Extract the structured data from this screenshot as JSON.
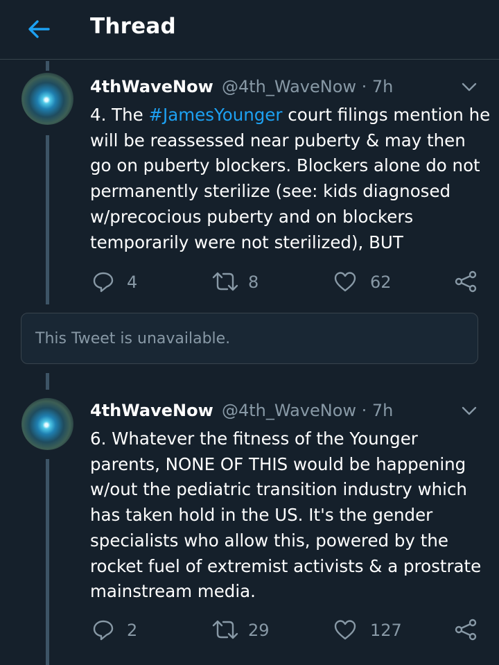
{
  "header": {
    "title": "Thread",
    "back_icon": "arrow-left-icon",
    "accent": "#1da1f2"
  },
  "tweets": [
    {
      "name": "4thWaveNow",
      "handle": "@4th_WaveNow · 7h",
      "text_prefix": "4. The ",
      "hashtag": "#JamesYounger",
      "text_rest": " court filings mention he will be reassessed near puberty & may then go on puberty blockers. Blockers alone do not permanently sterilize (see: kids diagnosed w/precocious puberty and on blockers temporarily were not sterilized), BUT",
      "replies": "4",
      "retweets": "8",
      "likes": "62"
    },
    {
      "name": "4thWaveNow",
      "handle": "@4th_WaveNow · 7h",
      "text": "6. Whatever the fitness of the Younger parents, NONE OF THIS would be happening w/out the pediatric transition industry which has taken hold in the US. It's the gender specialists who allow this, powered by the rocket fuel of extremist activists & a prostrate mainstream media.",
      "replies": "2",
      "retweets": "29",
      "likes": "127"
    }
  ],
  "unavailable": {
    "text": "This Tweet is unavailable."
  },
  "colors": {
    "background": "#15202b",
    "secondary_text": "#8899a6",
    "thread_line": "#3d5466"
  }
}
